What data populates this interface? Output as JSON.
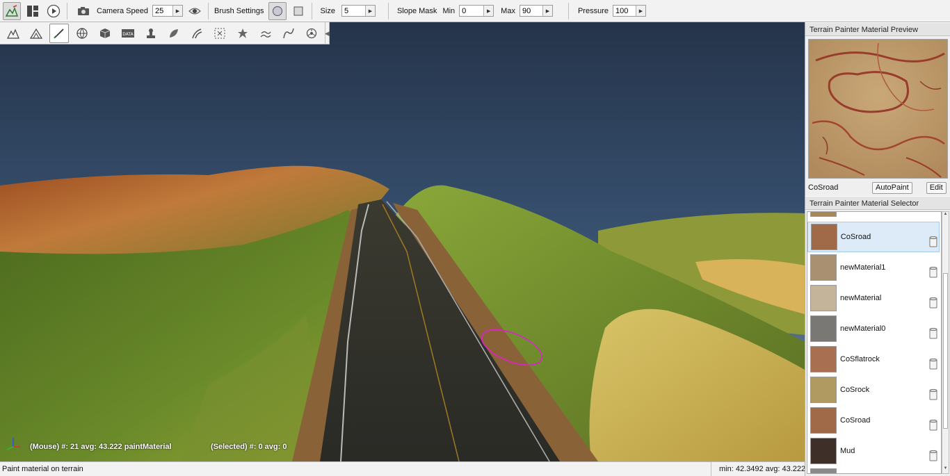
{
  "toolbar": {
    "camera_speed_label": "Camera Speed",
    "camera_speed_value": "25",
    "brush_settings_label": "Brush Settings",
    "size_label": "Size",
    "size_value": "5",
    "slope_mask_label": "Slope Mask",
    "min_label": "Min",
    "min_value": "0",
    "max_label": "Max",
    "max_value": "90",
    "pressure_label": "Pressure",
    "pressure_value": "100"
  },
  "viewport": {
    "mouse_readout": "(Mouse) #: 21  avg: 43.222 paintMaterial",
    "selected_readout": "(Selected) #: 0  avg: 0"
  },
  "right_panel": {
    "preview_title": "Terrain Painter Material Preview",
    "preview_material_name": "CoSroad",
    "autopaint_label": "AutoPaint",
    "edit_label": "Edit",
    "selector_title": "Terrain Painter Material Selector",
    "materials": [
      {
        "name": "CoSroad",
        "selected": true
      },
      {
        "name": "newMaterial1",
        "selected": false
      },
      {
        "name": "newMaterial",
        "selected": false
      },
      {
        "name": "newMaterial0",
        "selected": false
      },
      {
        "name": "CoSflatrock",
        "selected": false
      },
      {
        "name": "CoSrock",
        "selected": false
      },
      {
        "name": "CoSroad",
        "selected": false
      },
      {
        "name": "Mud",
        "selected": false
      }
    ]
  },
  "statusbar": {
    "message": "Paint material on terrain",
    "stats": "min: 42.3492  avg: 43.222"
  },
  "colors": {
    "brush_outline": "#e020d0",
    "sky_top": "#2a3a52",
    "selection_bg": "#dcebf7"
  }
}
